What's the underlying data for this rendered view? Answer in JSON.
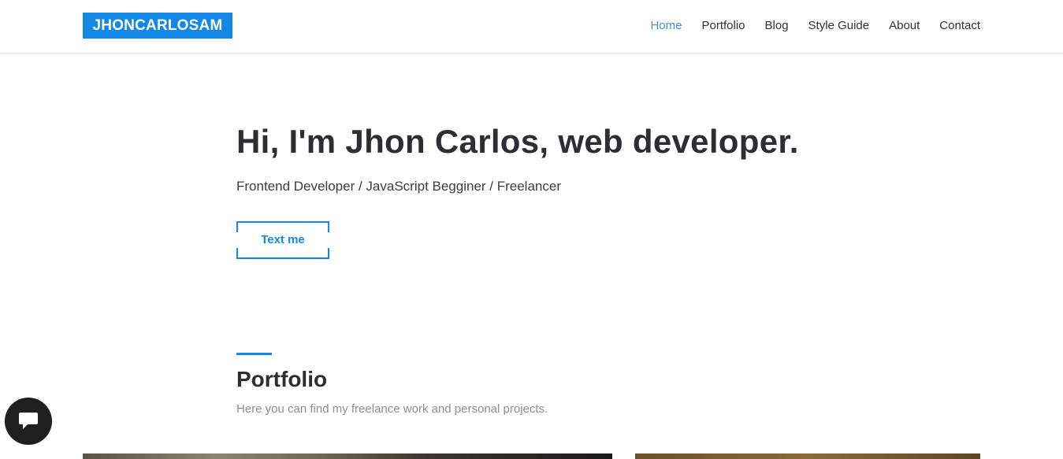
{
  "header": {
    "logo": "JHONCARLOSAM",
    "nav": [
      {
        "label": "Home",
        "active": true
      },
      {
        "label": "Portfolio",
        "active": false
      },
      {
        "label": "Blog",
        "active": false
      },
      {
        "label": "Style Guide",
        "active": false
      },
      {
        "label": "About",
        "active": false
      },
      {
        "label": "Contact",
        "active": false
      }
    ]
  },
  "hero": {
    "title": "Hi, I'm Jhon Carlos, web developer.",
    "subtitle": "Frontend Developer / JavaScript Begginer / Freelancer",
    "cta_label": "Text me"
  },
  "portfolio": {
    "title": "Portfolio",
    "description": "Here you can find my freelance work and personal projects."
  },
  "chat": {
    "icon": "chat-bubble-icon"
  },
  "colors": {
    "accent": "#1388e6",
    "nav_active": "#4a90d9",
    "text": "#2b2f33",
    "muted": "#8a9096"
  }
}
